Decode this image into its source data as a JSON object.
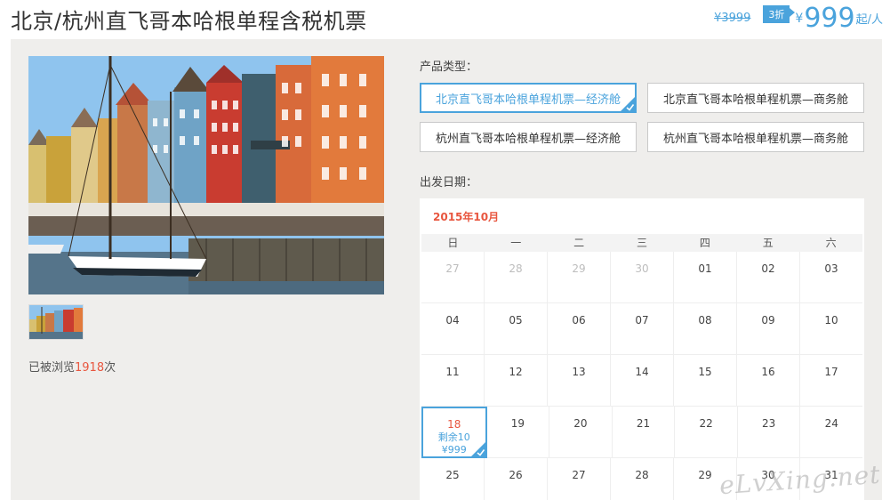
{
  "header": {
    "title": "北京/杭州直飞哥本哈根单程含税机票",
    "original_price": "¥3999",
    "discount": "3折",
    "currency": "¥",
    "price": "999",
    "unit": "起/人"
  },
  "gallery": {
    "views_prefix": "已被浏览",
    "views_count": "1918",
    "views_suffix": "次"
  },
  "product_type": {
    "label": "产品类型：",
    "options": [
      "北京直飞哥本哈根单程机票—经济舱",
      "北京直飞哥本哈根单程机票—商务舱",
      "杭州直飞哥本哈根单程机票—经济舱",
      "杭州直飞哥本哈根单程机票—商务舱"
    ],
    "selected_index": 0
  },
  "departure": {
    "label": "出发日期："
  },
  "calendar": {
    "month": "2015年10月",
    "weekdays": [
      "日",
      "一",
      "二",
      "三",
      "四",
      "五",
      "六"
    ],
    "weeks": [
      [
        "27",
        "28",
        "29",
        "30",
        "01",
        "02",
        "03"
      ],
      [
        "04",
        "05",
        "06",
        "07",
        "08",
        "09",
        "10"
      ],
      [
        "11",
        "12",
        "13",
        "14",
        "15",
        "16",
        "17"
      ],
      [
        "18",
        "19",
        "20",
        "21",
        "22",
        "23",
        "24"
      ],
      [
        "25",
        "26",
        "27",
        "28",
        "29",
        "30",
        "31"
      ]
    ],
    "selected_day": {
      "day": "18",
      "stock": "剩余10",
      "price": "¥999"
    }
  },
  "watermark": "eLvXing.net",
  "colors": {
    "accent": "#4aa3dc",
    "highlight": "#e8563f",
    "panel_bg": "#efeeec"
  }
}
